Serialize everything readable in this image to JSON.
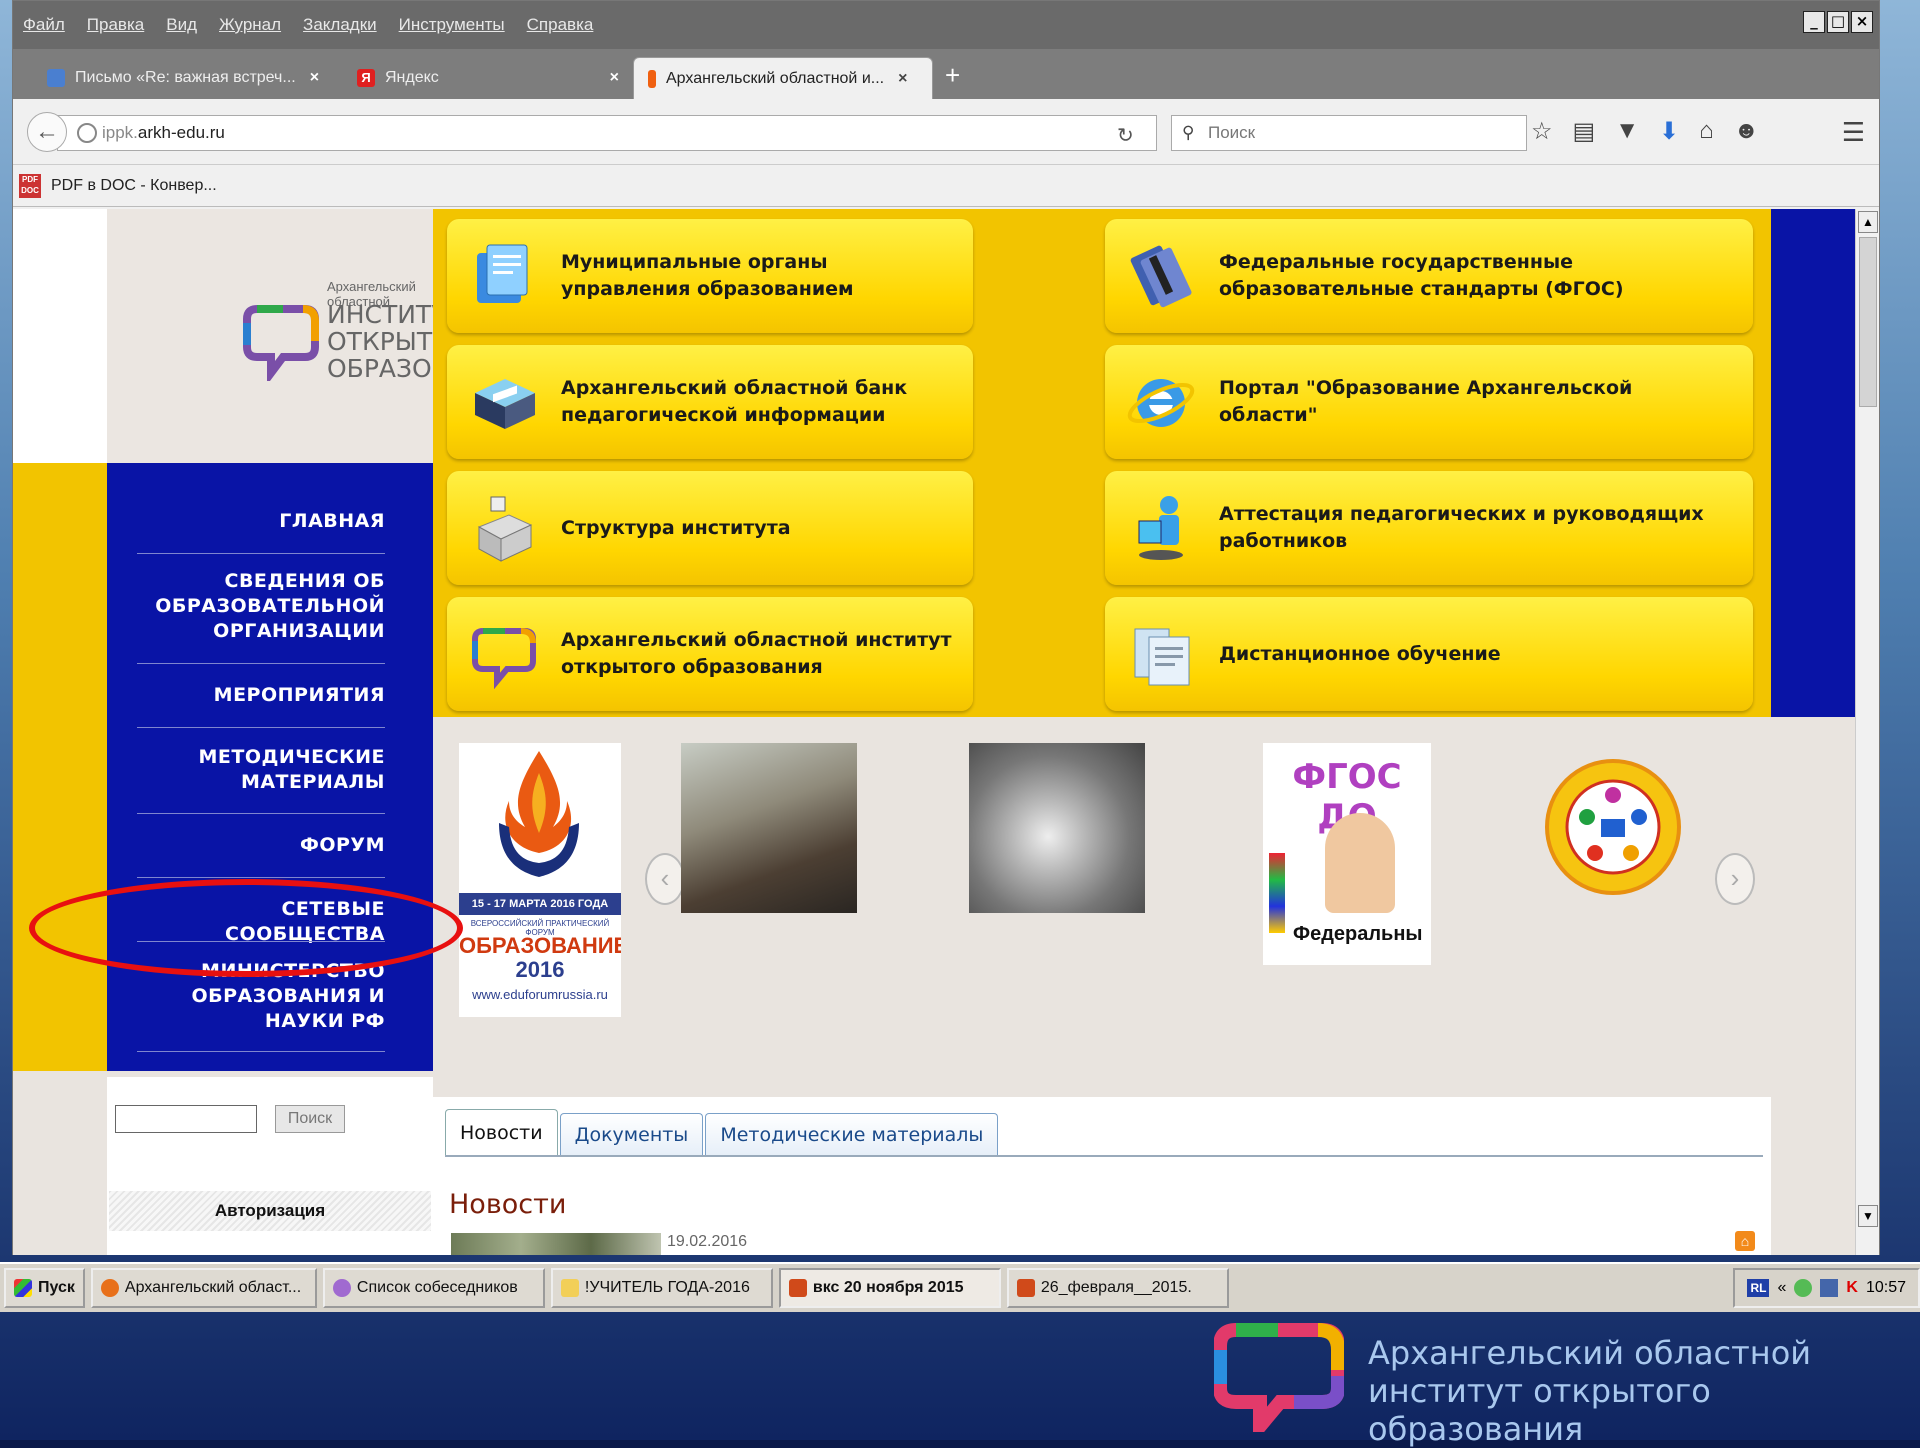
{
  "browser": {
    "menu": [
      "Файл",
      "Правка",
      "Вид",
      "Журнал",
      "Закладки",
      "Инструменты",
      "Справка"
    ],
    "window_controls": [
      "_",
      "□",
      "×"
    ],
    "tabs": [
      {
        "label": "Письмо «Re: важная встреч...",
        "close": "×"
      },
      {
        "label": "Яндекс",
        "close": "×"
      },
      {
        "label": "Архангельский областной и...",
        "close": "×"
      }
    ],
    "new_tab": "+",
    "url_host_prefix": "ippk.",
    "url_host": "arkh-edu.ru",
    "search_placeholder": "Поиск",
    "bookmark": "PDF в DOC - Конвер..."
  },
  "site": {
    "logo_small": "Архангельский областной",
    "logo_big": "ИНСТИТУТ\nОТКРЫТОГО\nОБРАЗОВАНИЯ",
    "nav": [
      "ГЛАВНАЯ",
      "СВЕДЕНИЯ ОБ ОБРАЗОВАТЕЛЬНОЙ ОРГАНИЗАЦИИ",
      "МЕРОПРИЯТИЯ",
      "МЕТОДИЧЕСКИЕ МАТЕРИАЛЫ",
      "ФОРУМ",
      "СЕТЕВЫЕ СООБЩЕСТВА",
      "МИНИСТЕРСТВО ОБРАЗОВАНИЯ И НАУКИ РФ"
    ],
    "tiles": [
      "Муниципальные органы управления образованием",
      "Федеральные государственные образовательные стандарты (ФГОС)",
      "Архангельский областной банк педагогической информации",
      "Портал \"Образование Архангельской области\"",
      "Структура института",
      "Аттестация педагогических и руководящих работников",
      "Архангельский областной институт открытого образования",
      "Дистанционное обучение"
    ],
    "slides": {
      "forum_dates": "15 - 17 МАРТА 2016 ГОДА",
      "forum_sub": "ВСЕРОССИЙСКИЙ ПРАКТИЧЕСКИЙ ФОРУМ",
      "forum_title": "ОБРАЗОВАНИЕ",
      "forum_year": "2016",
      "forum_url": "www.eduforumrussia.ru",
      "fgos_title": "ФГОС ДО",
      "fgos_caption": "Федеральны"
    },
    "slider_dots": 18,
    "slider_active_dot": 5,
    "search_button": "Поиск",
    "auth_title": "Авторизация",
    "content_tabs": [
      "Новости",
      "Документы",
      "Методические материалы"
    ],
    "news_heading": "Новости",
    "news_date": "19.02.2016"
  },
  "taskbar": {
    "start": "Пуск",
    "items": [
      "Архангельский област...",
      "Список собеседников",
      "!УЧИТЕЛЬ ГОДА-2016",
      "вкс 20 ноября 2015",
      "26_февраля__2015."
    ],
    "active_index": 3,
    "lang": "RL",
    "tray_chevron": "«",
    "clock": "10:57"
  },
  "footer": {
    "text": "Архангельский областной\nинститут открытого образования"
  },
  "colors": {
    "nav_blue": "#0914a6",
    "accent_yellow": "#f2c400",
    "highlight_red": "#e81010"
  }
}
